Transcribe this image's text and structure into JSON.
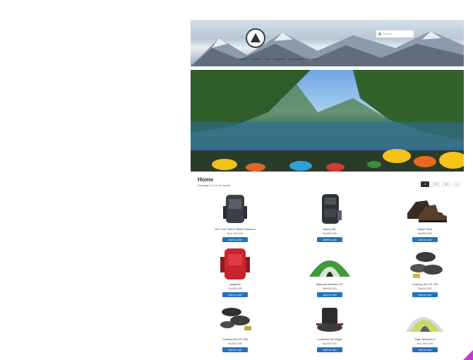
{
  "header": {
    "search_placeholder": "Search...",
    "nav": [
      "Home",
      "Products",
      "Cart",
      "Checkout",
      "My Account",
      "Contact"
    ]
  },
  "main": {
    "title": "Home",
    "result_count": "Showing 1–9 of 19 results",
    "pagination": [
      "1",
      "2",
      "3",
      "→"
    ]
  },
  "products": [
    {
      "name": "ACT one Stretch Black Diamond",
      "price": "Rp1.200.000",
      "button": "Add to cart"
    },
    {
      "name": "Alpine 50L",
      "price": "Rp950.000",
      "button": "Add to cart"
    },
    {
      "name": "Alpine Hiker",
      "price": "Rp850.000",
      "button": "Add to cart"
    },
    {
      "name": "Angelina",
      "price": "Rp450.000",
      "button": "Add to cart"
    },
    {
      "name": "Bantuan Monitera 4P",
      "price": "Rp900.000",
      "button": "Add to cart"
    },
    {
      "name": "Cooking Set CS 200",
      "price": "Rp250.000",
      "button": "Add to cart"
    },
    {
      "name": "Cooking Set DS 300",
      "price": "Rp300.000",
      "button": "Add to cart"
    },
    {
      "name": "Cooknest Set Eiger",
      "price": "Rp350.000",
      "button": "Add to cart"
    },
    {
      "name": "Eiger Monarch 4",
      "price": "Rp1.500.000",
      "button": "Add to cart"
    }
  ]
}
